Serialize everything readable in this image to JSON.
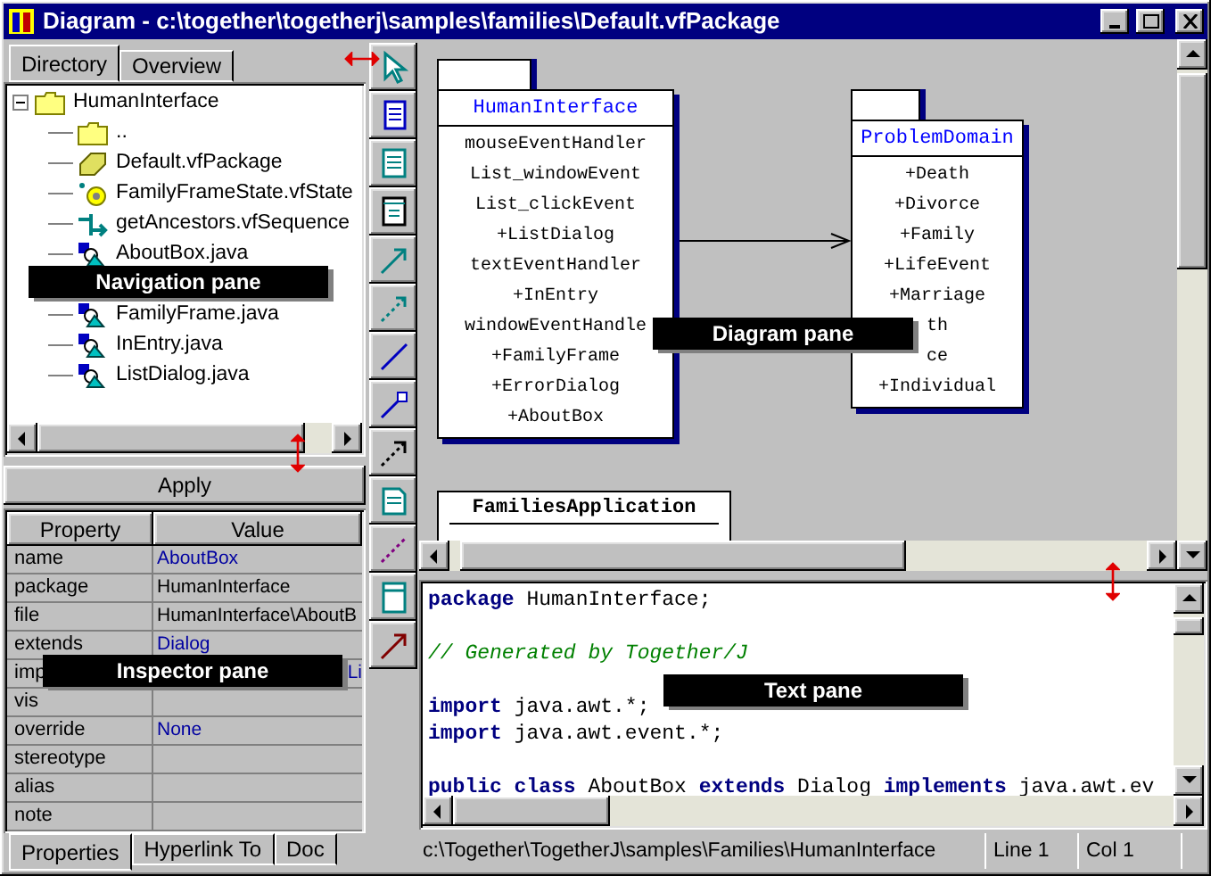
{
  "window": {
    "title": "Diagram - c:\\together\\togetherj\\samples\\families\\Default.vfPackage"
  },
  "navigator": {
    "tabs": [
      {
        "label": "Directory",
        "selected": true
      },
      {
        "label": "Overview",
        "selected": false
      }
    ],
    "tree": [
      {
        "label": "HumanInterface",
        "kind": "folder",
        "expanded": true,
        "children": [
          {
            "label": "..",
            "kind": "folder"
          },
          {
            "label": "Default.vfPackage",
            "kind": "package"
          },
          {
            "label": "FamilyFrameState.vfState",
            "kind": "state"
          },
          {
            "label": "getAncestors.vfSequence",
            "kind": "sequence"
          },
          {
            "label": "AboutBox.java",
            "kind": "class"
          },
          {
            "kind": "covered"
          },
          {
            "label": "FamilyFrame.java",
            "kind": "class"
          },
          {
            "label": "InEntry.java",
            "kind": "class"
          },
          {
            "label": "ListDialog.java",
            "kind": "class"
          }
        ]
      }
    ]
  },
  "apply_button": "Apply",
  "inspector": {
    "columns": [
      "Property",
      "Value"
    ],
    "rows": [
      {
        "property": "name",
        "value": "AboutBox",
        "link": true
      },
      {
        "property": "package",
        "value": "HumanInterface",
        "link": false
      },
      {
        "property": "file",
        "value": "HumanInterface\\AboutB",
        "link": false
      },
      {
        "property": "extends",
        "value": "Dialog",
        "link": true
      },
      {
        "property": "imp",
        "value": "Li",
        "link": true,
        "tail": true
      },
      {
        "property": "vis"
      },
      {
        "property": "override",
        "value": "None",
        "link": true
      },
      {
        "property": "stereotype"
      },
      {
        "property": "alias"
      },
      {
        "property": "note"
      }
    ],
    "tabs": [
      {
        "label": "Properties",
        "selected": true
      },
      {
        "label": "Hyperlink To",
        "selected": false
      },
      {
        "label": "Doc",
        "selected": false
      }
    ]
  },
  "diagram": {
    "elements": [
      {
        "kind": "package",
        "title": "HumanInterface",
        "items": [
          "mouseEventHandler",
          "List_windowEvent",
          "List_clickEvent",
          "+ListDialog",
          "textEventHandler",
          "+InEntry",
          "windowEventHandle",
          "+FamilyFrame",
          "+ErrorDialog",
          "+AboutBox"
        ]
      },
      {
        "kind": "package",
        "title": "ProblemDomain",
        "items": [
          "+Death",
          "+Divorce",
          "+Family",
          "+LifeEvent",
          "+Marriage",
          "th",
          "ce",
          "+Individual"
        ]
      },
      {
        "kind": "class",
        "title": "FamiliesApplication"
      }
    ]
  },
  "text_pane": {
    "lines": [
      {
        "kind": "code",
        "segments": [
          {
            "kind": "keyword",
            "text": "package"
          },
          {
            "kind": "plain",
            "text": " HumanInterface;"
          }
        ]
      },
      {
        "kind": "blank"
      },
      {
        "kind": "code",
        "segments": [
          {
            "kind": "comment",
            "text": "// Generated by Together/J"
          }
        ]
      },
      {
        "kind": "blank"
      },
      {
        "kind": "code",
        "segments": [
          {
            "kind": "keyword",
            "text": "import"
          },
          {
            "kind": "plain",
            "text": " java.awt.*;"
          }
        ]
      },
      {
        "kind": "code",
        "segments": [
          {
            "kind": "keyword",
            "text": "import"
          },
          {
            "kind": "plain",
            "text": " java.awt.event.*;"
          }
        ]
      },
      {
        "kind": "blank"
      },
      {
        "kind": "code",
        "segments": [
          {
            "kind": "keyword",
            "text": "public class"
          },
          {
            "kind": "plain",
            "text": " AboutBox "
          },
          {
            "kind": "keyword",
            "text": "extends"
          },
          {
            "kind": "plain",
            "text": " Dialog "
          },
          {
            "kind": "keyword",
            "text": "implements"
          },
          {
            "kind": "plain",
            "text": " java.awt.ev"
          }
        ]
      }
    ]
  },
  "status_bar": {
    "path": "c:\\Together\\TogetherJ\\samples\\Families\\HumanInterface",
    "line": "Line 1",
    "column": "Col 1"
  },
  "callouts": [
    {
      "label": "Navigation pane"
    },
    {
      "label": "Diagram pane"
    },
    {
      "label": "Inspector pane"
    },
    {
      "label": "Text pane"
    }
  ]
}
